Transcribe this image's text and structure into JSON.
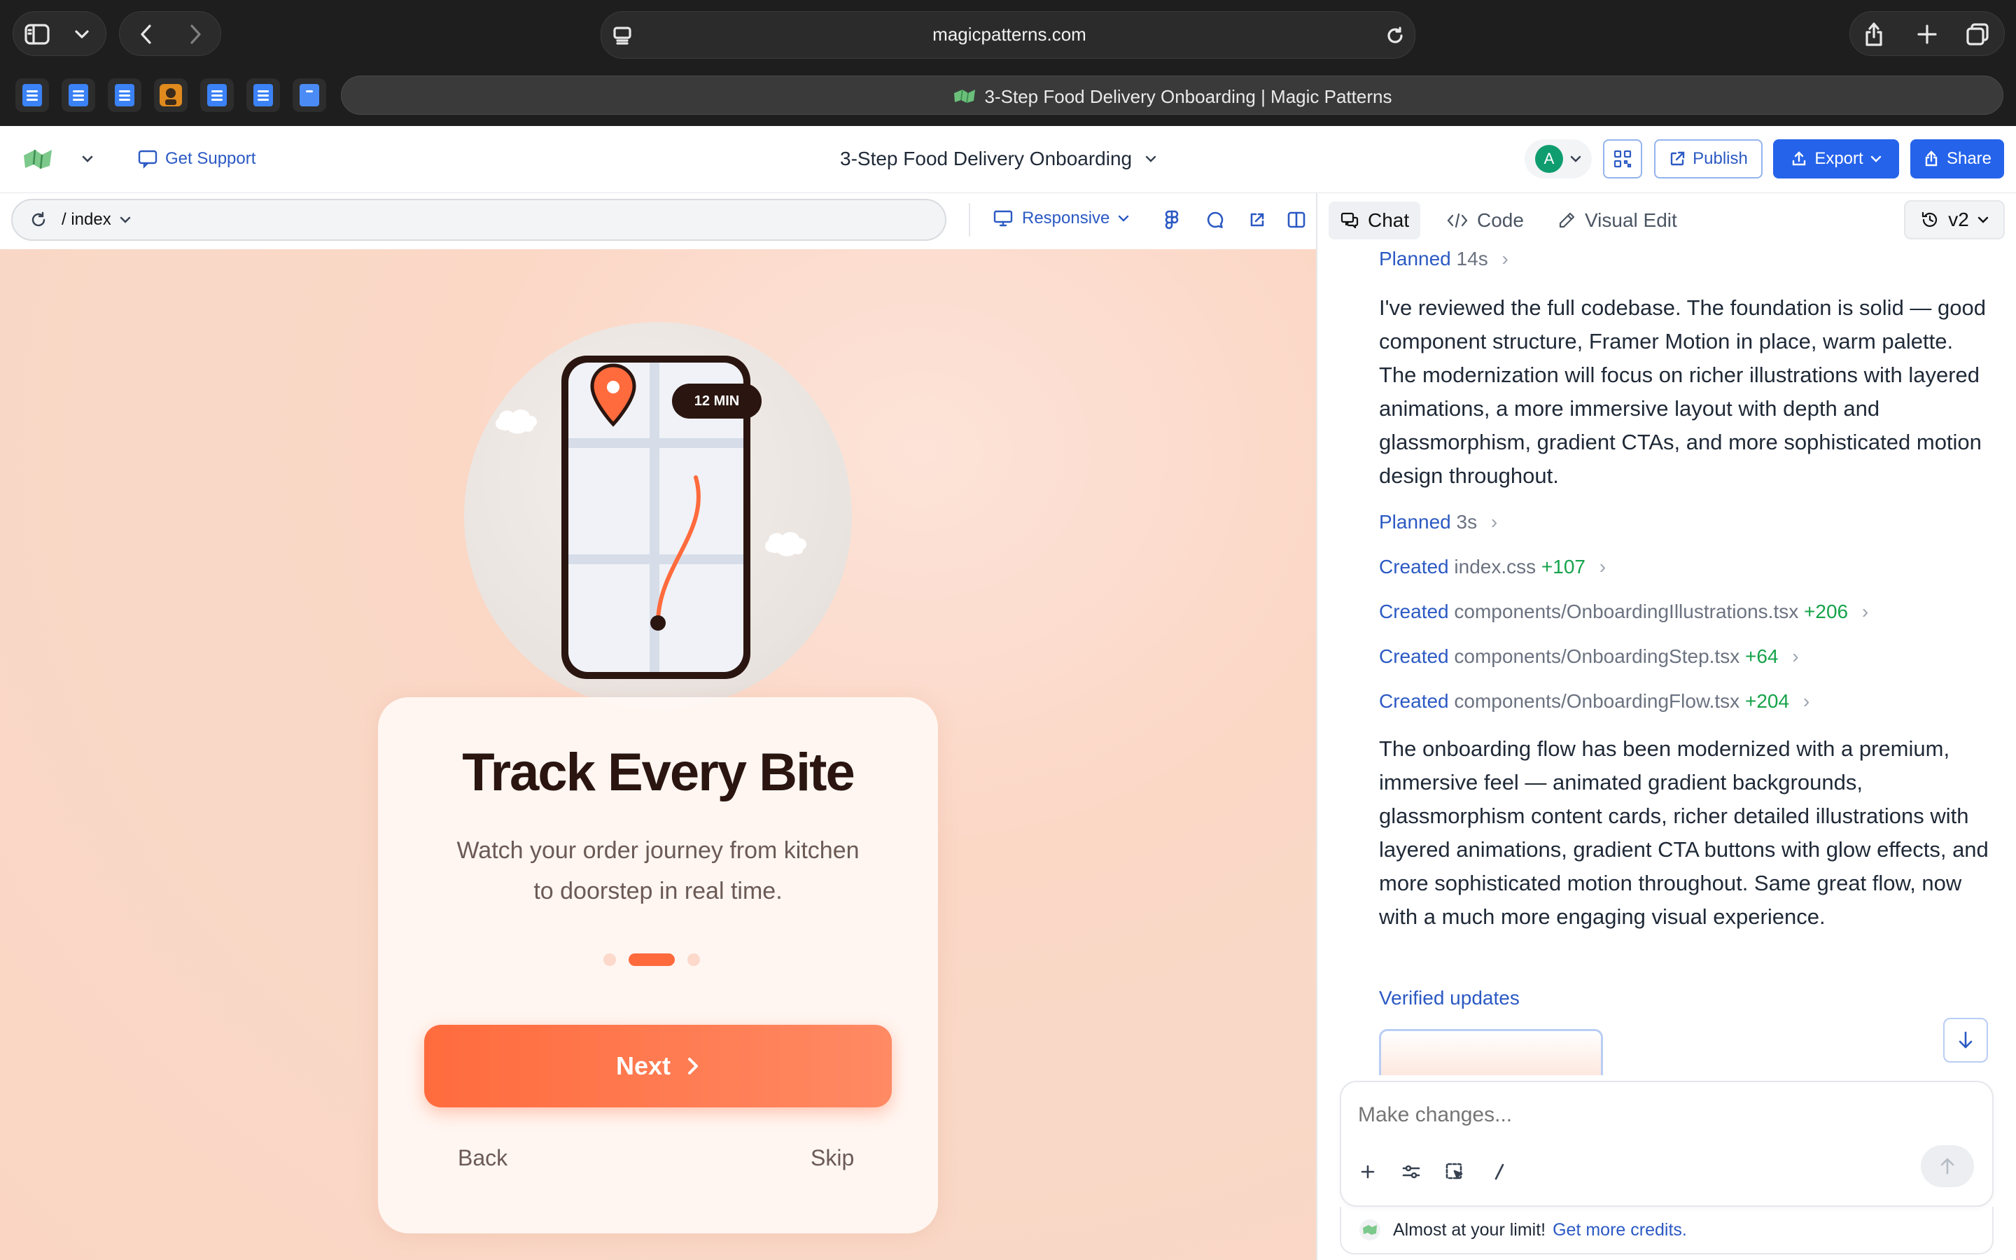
{
  "browser": {
    "url": "magicpatterns.com",
    "tab_title": "3-Step Food Delivery Onboarding | Magic Patterns"
  },
  "header": {
    "support_label": "Get Support",
    "project_title": "3-Step Food Delivery Onboarding",
    "avatar_initial": "A",
    "publish_label": "Publish",
    "export_label": "Export",
    "share_label": "Share",
    "accent_color": "#2563eb"
  },
  "toolbar": {
    "path": "/ index",
    "responsive_label": "Responsive"
  },
  "panel_tabs": {
    "chat": "Chat",
    "code": "Code",
    "visual_edit": "Visual Edit",
    "version": "v2"
  },
  "preview": {
    "eta_badge": "12 MIN",
    "title": "Track Every Bite",
    "subtitle_line1": "Watch your order journey from kitchen",
    "subtitle_line2": "to doorstep in real time.",
    "step_current": 2,
    "step_total": 3,
    "next_label": "Next",
    "back_label": "Back",
    "skip_label": "Skip",
    "brand_color": "#ff6b3d"
  },
  "chat": {
    "planned_1": {
      "verb": "Planned",
      "time": "14s"
    },
    "message_1": "I've reviewed the full codebase. The foundation is solid — good component structure, Framer Motion in place, warm palette. The modernization will focus on richer illustrations with layered animations, a more immersive layout with depth and glassmorphism, gradient CTAs, and more sophisticated motion design throughout.",
    "planned_2": {
      "verb": "Planned",
      "time": "3s"
    },
    "files": [
      {
        "verb": "Created",
        "path": "index.css",
        "delta": "+107"
      },
      {
        "verb": "Created",
        "path": "components/OnboardingIllustrations.tsx",
        "delta": "+206"
      },
      {
        "verb": "Created",
        "path": "components/OnboardingStep.tsx",
        "delta": "+64"
      },
      {
        "verb": "Created",
        "path": "components/OnboardingFlow.tsx",
        "delta": "+204"
      }
    ],
    "message_2": "The onboarding flow has been modernized with a premium, immersive feel — animated gradient backgrounds, glassmorphism content cards, richer detailed illustrations with layered animations, gradient CTA buttons with glow effects, and more sophisticated motion throughout. Same great flow, now with a much more engaging visual experience.",
    "verified_label": "Verified updates",
    "input_placeholder": "Make changes...",
    "limit_text": "Almost at your limit!",
    "credits_link": "Get more credits."
  }
}
